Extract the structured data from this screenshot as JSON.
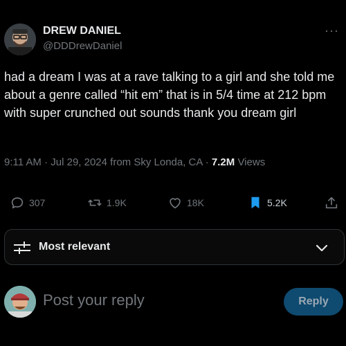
{
  "author": {
    "name": "DREW DANIEL",
    "handle": "@DDDrewDaniel"
  },
  "more_label": "···",
  "tweet": {
    "text": "had a dream I was at a rave talking to a girl and she told me about a genre called “hit em” that is in 5/4 time at 212 bpm with super crunched out sounds thank you dream girl"
  },
  "meta": {
    "time": "9:11 AM",
    "sep1": " · ",
    "date": "Jul 29, 2024",
    "from": " from Sky Londa, CA",
    "sep2": " · ",
    "views_count": "7.2M",
    "views_label": " Views"
  },
  "actions": {
    "replies": "307",
    "reposts": "1.9K",
    "likes": "18K",
    "bookmarks": "5.2K"
  },
  "sort": {
    "label": "Most relevant"
  },
  "composer": {
    "placeholder": "Post your reply",
    "button_label": "Reply"
  },
  "colors": {
    "background": "#000000",
    "secondary_text": "#71767b",
    "bookmark_active": "#1d9bf0",
    "reply_button_disabled": "#0f4a70"
  },
  "icons": {
    "more": "more-horizontal-icon",
    "reply": "speech-bubble-icon",
    "repost": "repost-arrows-icon",
    "like": "heart-icon",
    "bookmark": "bookmark-filled-icon",
    "share": "share-upload-icon",
    "sort": "sliders-icon",
    "expand": "chevron-down-icon"
  }
}
